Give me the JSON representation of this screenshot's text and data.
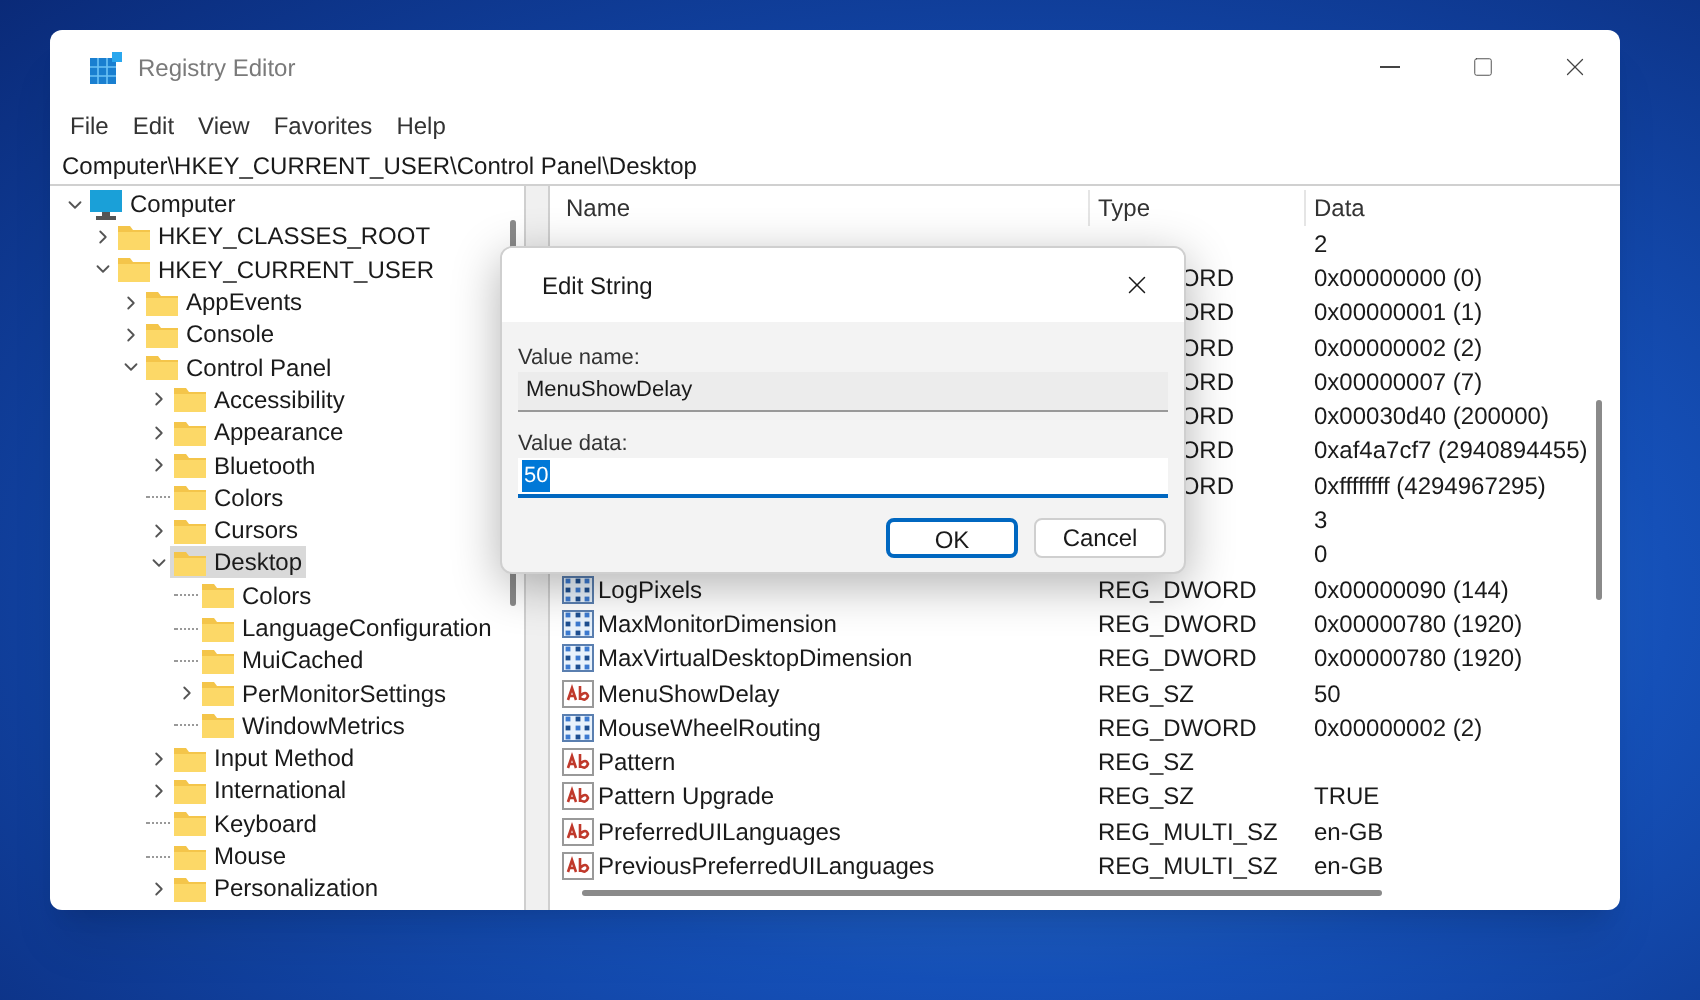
{
  "window": {
    "title": "Registry Editor"
  },
  "menu": [
    "File",
    "Edit",
    "View",
    "Favorites",
    "Help"
  ],
  "address": "Computer\\HKEY_CURRENT_USER\\Control Panel\\Desktop",
  "tree": [
    {
      "label": "Computer",
      "kind": "root",
      "expanded": true,
      "selected": false,
      "children": [
        {
          "label": "HKEY_CLASSES_ROOT",
          "kind": "branch",
          "expanded": false,
          "selected": false
        },
        {
          "label": "HKEY_CURRENT_USER",
          "kind": "branch",
          "expanded": true,
          "selected": false,
          "children": [
            {
              "label": "AppEvents",
              "kind": "branch",
              "expanded": false,
              "selected": false
            },
            {
              "label": "Console",
              "kind": "branch",
              "expanded": false,
              "selected": false
            },
            {
              "label": "Control Panel",
              "kind": "branch",
              "expanded": true,
              "selected": false,
              "children": [
                {
                  "label": "Accessibility",
                  "kind": "branch",
                  "expanded": false,
                  "selected": false
                },
                {
                  "label": "Appearance",
                  "kind": "branch",
                  "expanded": false,
                  "selected": false
                },
                {
                  "label": "Bluetooth",
                  "kind": "branch",
                  "expanded": false,
                  "selected": false
                },
                {
                  "label": "Colors",
                  "kind": "leaf",
                  "selected": false
                },
                {
                  "label": "Cursors",
                  "kind": "branch",
                  "expanded": false,
                  "selected": false
                },
                {
                  "label": "Desktop",
                  "kind": "branch",
                  "expanded": true,
                  "selected": true,
                  "children": [
                    {
                      "label": "Colors",
                      "kind": "leaf",
                      "selected": false
                    },
                    {
                      "label": "LanguageConfiguration",
                      "kind": "leaf",
                      "selected": false
                    },
                    {
                      "label": "MuiCached",
                      "kind": "leaf",
                      "selected": false
                    },
                    {
                      "label": "PerMonitorSettings",
                      "kind": "branch",
                      "expanded": false,
                      "selected": false
                    },
                    {
                      "label": "WindowMetrics",
                      "kind": "leaf",
                      "selected": false
                    }
                  ]
                },
                {
                  "label": "Input Method",
                  "kind": "branch",
                  "expanded": false,
                  "selected": false
                },
                {
                  "label": "International",
                  "kind": "branch",
                  "expanded": false,
                  "selected": false
                },
                {
                  "label": "Keyboard",
                  "kind": "leaf",
                  "selected": false
                },
                {
                  "label": "Mouse",
                  "kind": "leaf",
                  "selected": false
                },
                {
                  "label": "Personalization",
                  "kind": "branch",
                  "expanded": false,
                  "selected": false
                }
              ]
            }
          ]
        }
      ]
    }
  ],
  "values": {
    "columns": [
      "Name",
      "Type",
      "Data"
    ],
    "rows": [
      {
        "kind": "hidden",
        "data": "2"
      },
      {
        "kind": "hidden",
        "type": "ORD",
        "data": "0x00000000 (0)"
      },
      {
        "kind": "hidden",
        "type": "ORD",
        "data": "0x00000001 (1)"
      },
      {
        "kind": "hidden",
        "type": "ORD",
        "data": "0x00000002 (2)"
      },
      {
        "kind": "hidden",
        "type": "ORD",
        "data": "0x00000007 (7)"
      },
      {
        "kind": "hidden",
        "type": "ORD",
        "data": "0x00030d40 (200000)"
      },
      {
        "kind": "hidden",
        "type": "ORD",
        "data": "0xaf4a7cf7 (2940894455)"
      },
      {
        "kind": "hidden",
        "type": "ORD",
        "data": "0xffffffff (4294967295)"
      },
      {
        "kind": "hidden",
        "data": "3"
      },
      {
        "kind": "hidden",
        "data": "0"
      },
      {
        "kind": "number",
        "name": "LogPixels",
        "type": "REG_DWORD",
        "data": "0x00000090 (144)"
      },
      {
        "kind": "number",
        "name": "MaxMonitorDimension",
        "type": "REG_DWORD",
        "data": "0x00000780 (1920)"
      },
      {
        "kind": "number",
        "name": "MaxVirtualDesktopDimension",
        "type": "REG_DWORD",
        "data": "0x00000780 (1920)"
      },
      {
        "kind": "string",
        "name": "MenuShowDelay",
        "type": "REG_SZ",
        "data": "50"
      },
      {
        "kind": "number",
        "name": "MouseWheelRouting",
        "type": "REG_DWORD",
        "data": "0x00000002 (2)"
      },
      {
        "kind": "string",
        "name": "Pattern",
        "type": "REG_SZ"
      },
      {
        "kind": "string",
        "name": "Pattern Upgrade",
        "type": "REG_SZ",
        "data": "TRUE"
      },
      {
        "kind": "string",
        "name": "PreferredUILanguages",
        "type": "REG_MULTI_SZ",
        "data": "en-GB"
      },
      {
        "kind": "string",
        "name": "PreviousPreferredUILanguages",
        "type": "REG_MULTI_SZ",
        "data": "en-GB"
      }
    ]
  },
  "dialog": {
    "title": "Edit String",
    "name_label": "Value name:",
    "name_value": "MenuShowDelay",
    "data_label": "Value data:",
    "data_value": "50",
    "buttons": [
      {
        "label": "OK",
        "default": true
      },
      {
        "label": "Cancel",
        "default": false
      }
    ]
  }
}
